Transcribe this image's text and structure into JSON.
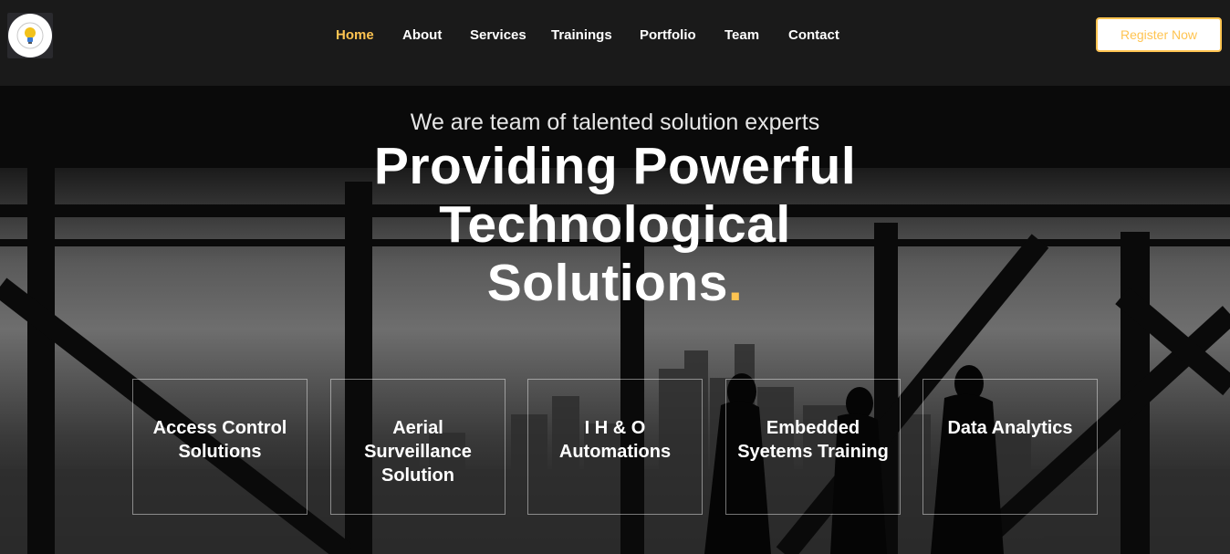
{
  "nav": {
    "items": [
      {
        "label": "Home",
        "active": true
      },
      {
        "label": "About"
      },
      {
        "label": "Services"
      },
      {
        "label": "Trainings"
      },
      {
        "label": "Portfolio"
      },
      {
        "label": "Team"
      },
      {
        "label": "Contact"
      }
    ],
    "register_label": "Register Now"
  },
  "hero": {
    "subtitle": "We are team of talented solution experts",
    "title": "Providing Powerful Technological Solutions",
    "title_dot": "."
  },
  "services": [
    {
      "label": "Access Control Solutions"
    },
    {
      "label": "Aerial Surveillance Solution"
    },
    {
      "label": "I H & O Automations"
    },
    {
      "label": "Embedded Syetems Training"
    },
    {
      "label": "Data Analytics"
    }
  ],
  "colors": {
    "accent": "#ffc451",
    "header_bg": "#1a1a1a"
  },
  "icons": {
    "logo": "lightbulb-icon"
  }
}
